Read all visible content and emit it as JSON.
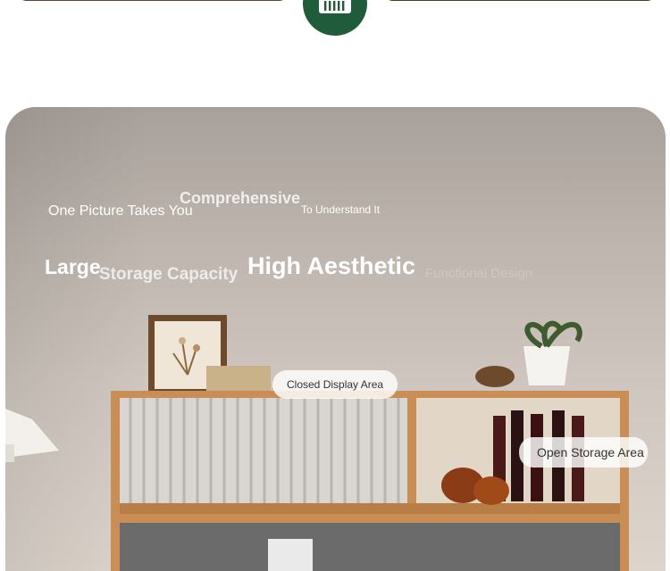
{
  "hero": {
    "headline_1": "One Picture Takes You",
    "headline_2": "Comprehensive",
    "headline_3": "To Understand It",
    "feature_1": "Large",
    "feature_2": "Storage Capacity",
    "feature_3": "High Aesthetic",
    "feature_4": "Functional Design"
  },
  "callouts": {
    "closed": "Closed Display Area",
    "open": "Open Storage Area"
  },
  "colors": {
    "badge": "#205c3c",
    "cabinet_wood": "#c98e55"
  },
  "icons": {
    "badge": "cabinet-icon"
  }
}
